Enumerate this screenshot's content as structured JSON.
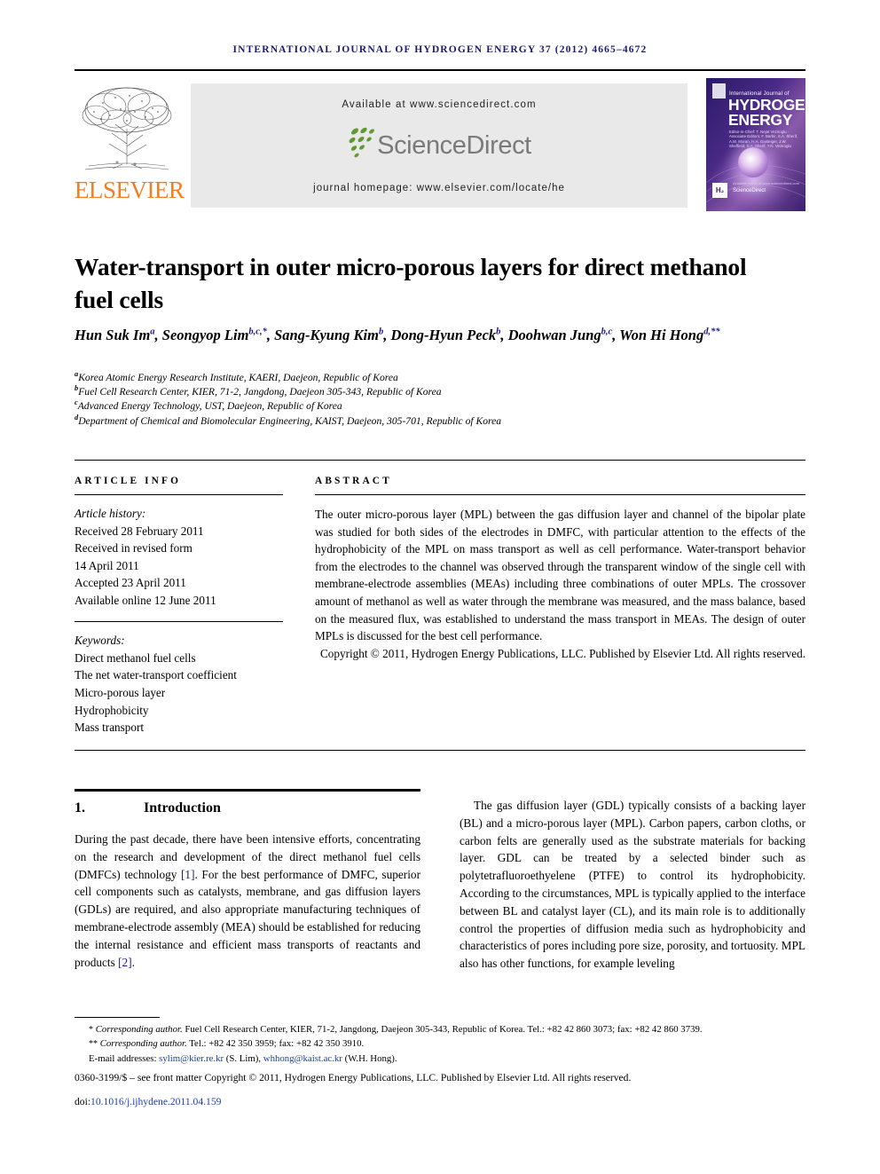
{
  "running_head": "International Journal of Hydrogen Energy 37 (2012) 4665–4672",
  "masthead": {
    "elsevier_wordmark": "ELSEVIER",
    "available_at": "Available at www.sciencedirect.com",
    "sciencedirect_wordmark": "ScienceDirect",
    "journal_homepage": "journal homepage: www.elsevier.com/locate/he",
    "cover": {
      "line_small": "International Journal of",
      "title_line1": "HYDROGEN",
      "title_line2": "ENERGY",
      "editors": "Editor-in-Chief: T. Nejat Veziroglu · Associate Editors: F. Barbir, S.A. Sherif, A.M. Moran, H.A. Gasteiger, J.W. Sheffield, S.A. Sherif, T.N. Veziroglu",
      "he_mark": "H₂",
      "sciencedirect_mark": "ScienceDirect",
      "sd_note": "Available online at www.sciencedirect.com"
    }
  },
  "colors": {
    "elsevier_orange": "#F57C20",
    "sciencedirect_gray": "#7a7a7a",
    "sciencedirect_green": "#5f9a2f",
    "link_blue": "#1a3fae",
    "superscript_blue": "#1a1a8c",
    "banner_gray": "#e9e9e9",
    "runhead_navy": "#1a1a6e"
  },
  "article": {
    "title": "Water-transport in outer micro-porous layers for direct methanol fuel cells",
    "authors": [
      {
        "name": "Hun Suk Im",
        "sup": "a",
        "sep": ", "
      },
      {
        "name": "Seongyop Lim",
        "sup": "b,c,*",
        "sep": ", "
      },
      {
        "name": "Sang-Kyung Kim",
        "sup": "b",
        "sep": ", "
      },
      {
        "name": "Dong-Hyun Peck",
        "sup": "b",
        "sep": ", "
      },
      {
        "name": "Doohwan Jung",
        "sup": "b,c",
        "sep": ", "
      },
      {
        "name": "Won Hi Hong",
        "sup": "d,**",
        "sep": ""
      }
    ],
    "affiliations": [
      {
        "marker": "a",
        "text": "Korea Atomic Energy Research Institute, KAERI, Daejeon, Republic of Korea"
      },
      {
        "marker": "b",
        "text": "Fuel Cell Research Center, KIER, 71-2, Jangdong, Daejeon 305-343, Republic of Korea"
      },
      {
        "marker": "c",
        "text": "Advanced Energy Technology, UST, Daejeon, Republic of Korea"
      },
      {
        "marker": "d",
        "text": "Department of Chemical and Biomolecular Engineering, KAIST, Daejeon, 305-701, Republic of Korea"
      }
    ]
  },
  "article_info": {
    "heading": "ARTICLE INFO",
    "history_label": "Article history:",
    "history": [
      "Received 28 February 2011",
      "Received in revised form",
      "14 April 2011",
      "Accepted 23 April 2011",
      "Available online 12 June 2011"
    ],
    "keywords_label": "Keywords:",
    "keywords": [
      "Direct methanol fuel cells",
      "The net water-transport coefficient",
      "Micro-porous layer",
      "Hydrophobicity",
      "Mass transport"
    ]
  },
  "abstract": {
    "heading": "ABSTRACT",
    "text": "The outer micro-porous layer (MPL) between the gas diffusion layer and channel of the bipolar plate was studied for both sides of the electrodes in DMFC, with particular attention to the effects of the hydrophobicity of the MPL on mass transport as well as cell performance. Water-transport behavior from the electrodes to the channel was observed through the transparent window of the single cell with membrane-electrode assemblies (MEAs) including three combinations of outer MPLs. The crossover amount of methanol as well as water through the membrane was measured, and the mass balance, based on the measured flux, was established to understand the mass transport in MEAs. The design of outer MPLs is discussed for the best cell performance.",
    "copyright": "Copyright © 2011, Hydrogen Energy Publications, LLC. Published by Elsevier Ltd. All rights reserved."
  },
  "body": {
    "section_number": "1.",
    "section_title": "Introduction",
    "left_paragraph_parts": {
      "p1": "During the past decade, there have been intensive efforts, concentrating on the research and development of the direct methanol fuel cells (DMFCs) technology ",
      "ref1": "[1]",
      "p2": ". For the best performance of DMFC, superior cell components such as catalysts, membrane, and gas diffusion layers (GDLs) are required, and also appropriate manufacturing techniques of membrane-electrode assembly (MEA) should be established for reducing the internal resistance and efficient mass transports of reactants and products ",
      "ref2": "[2]",
      "p3": "."
    },
    "right_paragraph": "The gas diffusion layer (GDL) typically consists of a backing layer (BL) and a micro-porous layer (MPL). Carbon papers, carbon cloths, or carbon felts are generally used as the substrate materials for backing layer. GDL can be treated by a selected binder such as polytetrafluoroethyelene (PTFE) to control its hydrophobicity. According to the circumstances, MPL is typically applied to the interface between BL and catalyst layer (CL), and its main role is to additionally control the properties of diffusion media such as hydrophobicity and characteristics of pores including pore size, porosity, and tortuosity. MPL also has other functions, for example leveling"
  },
  "footnotes": {
    "corresponding1_marker": "*",
    "corresponding1": "Corresponding author.",
    "corresponding1_rest": " Fuel Cell Research Center, KIER, 71-2, Jangdong, Daejeon 305-343, Republic of Korea. Tel.: +82 42 860 3073; fax: +82 42 860 3739.",
    "corresponding2_marker": "**",
    "corresponding2": "Corresponding author.",
    "corresponding2_rest": " Tel.: +82 42 350 3959; fax: +82 42 350 3910.",
    "email_label": "E-mail addresses:",
    "email1": "sylim@kier.re.kr",
    "email1_owner": "(S. Lim)",
    "email2": "whhong@kaist.ac.kr",
    "email2_owner": "(W.H. Hong).",
    "issn_line": "0360-3199/$ – see front matter Copyright © 2011, Hydrogen Energy Publications, LLC. Published by Elsevier Ltd. All rights reserved.",
    "doi_label": "doi:",
    "doi_value": "10.1016/j.ijhydene.2011.04.159"
  }
}
